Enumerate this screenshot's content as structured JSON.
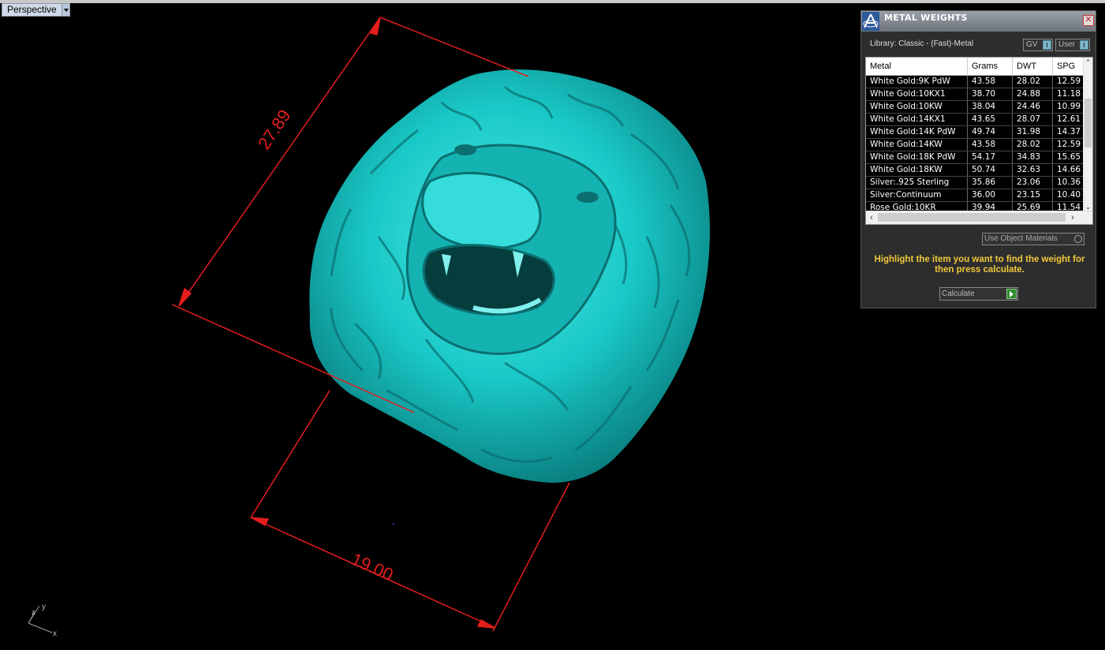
{
  "viewport": {
    "label": "Perspective",
    "dim_vertical": "27.89",
    "dim_horizontal": "19.00",
    "axis_y": "y",
    "axis_x": "x",
    "axis_z": "z",
    "model_color": "#1ec8c8",
    "dim_color": "#e41e1e"
  },
  "panel": {
    "title": "METAL WEIGHTS",
    "library": "Library: Classic - (Fast)-Metal",
    "toggle_gv": "GV",
    "toggle_user": "User",
    "columns": [
      "Metal",
      "Grams",
      "DWT",
      "SPG"
    ],
    "rows": [
      [
        "White Gold:9K PdW",
        "43.58",
        "28.02",
        "12.59"
      ],
      [
        "White Gold:10KX1",
        "38.70",
        "24.88",
        "11.18"
      ],
      [
        "White Gold:10KW",
        "38.04",
        "24.46",
        "10.99"
      ],
      [
        "White Gold:14KX1",
        "43.65",
        "28.07",
        "12.61"
      ],
      [
        "White Gold:14K PdW",
        "49.74",
        "31.98",
        "14.37"
      ],
      [
        "White Gold:14KW",
        "43.58",
        "28.02",
        "12.59"
      ],
      [
        "White Gold:18K PdW",
        "54.17",
        "34.83",
        "15.65"
      ],
      [
        "White Gold:18KW",
        "50.74",
        "32.63",
        "14.66"
      ],
      [
        "Silver:.925 Sterling",
        "35.86",
        "23.06",
        "10.36"
      ],
      [
        "Silver:Continuum",
        "36.00",
        "23.15",
        "10.40"
      ],
      [
        "Rose Gold:10KR",
        "39.94",
        "25.69",
        "11.54"
      ]
    ],
    "use_object_materials": "Use Object Materials",
    "hint": "Highlight the item you want to find the weight for then press calculate.",
    "calculate": "Calculate"
  }
}
